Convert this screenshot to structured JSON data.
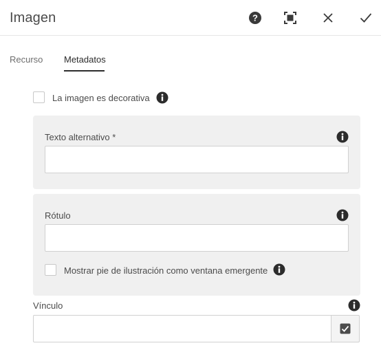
{
  "dialog": {
    "title": "Imagen",
    "actions": {
      "help_icon": "help-icon",
      "fullscreen_icon": "fullscreen-icon",
      "close_icon": "close-icon",
      "confirm_icon": "checkmark-icon"
    }
  },
  "tabs": [
    {
      "label": "Recurso",
      "active": false
    },
    {
      "label": "Metadatos",
      "active": true
    }
  ],
  "decorative": {
    "label": "La imagen es decorativa",
    "checked": false
  },
  "alt_text": {
    "label": "Texto alternativo *",
    "value": ""
  },
  "caption": {
    "label": "Rótulo",
    "value": "",
    "popup_label": "Mostrar pie de ilustración como ventana emergente",
    "popup_checked": false
  },
  "link": {
    "label": "Vínculo",
    "value": "",
    "picker_icon": "check-square-icon"
  },
  "colors": {
    "panel_bg": "#f0f0f0",
    "icon": "#2c2c2c"
  }
}
